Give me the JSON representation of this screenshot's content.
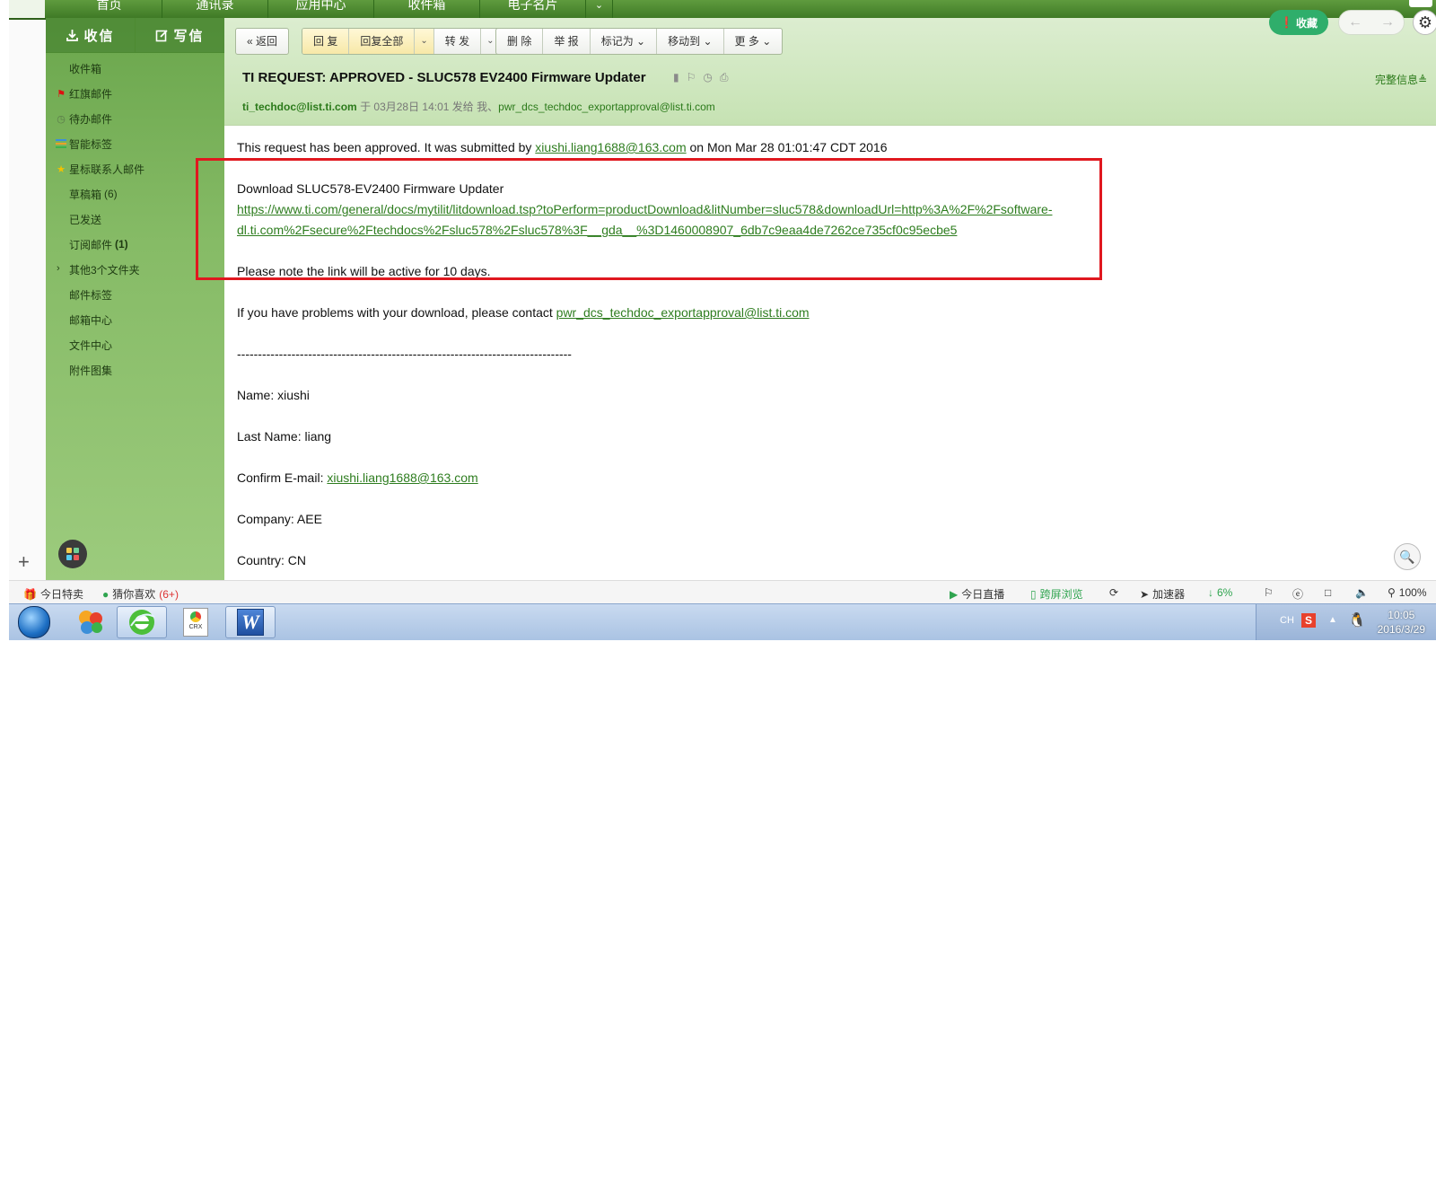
{
  "top_nav": {
    "tabs": [
      "首页",
      "通讯录",
      "应用中心",
      "收件箱",
      "电子名片"
    ],
    "dropdown": "⌄"
  },
  "sidebar": {
    "receive_label": "收信",
    "compose_label": "写信",
    "items": [
      {
        "label": "收件箱",
        "count": "",
        "icon": ""
      },
      {
        "label": "红旗邮件",
        "count": "",
        "icon": "flag-icon"
      },
      {
        "label": "待办邮件",
        "count": "",
        "icon": "clock-icon"
      },
      {
        "label": "智能标签",
        "count": "",
        "icon": "tags-icon"
      },
      {
        "label": "星标联系人邮件",
        "count": "",
        "icon": "star-icon"
      },
      {
        "label": "草稿箱",
        "count": "(6)",
        "icon": ""
      },
      {
        "label": "已发送",
        "count": "",
        "icon": ""
      },
      {
        "label": "订阅邮件",
        "count": "(1)",
        "icon": ""
      },
      {
        "label": "其他3个文件夹",
        "count": "",
        "icon": "chevron-right-icon"
      },
      {
        "label": "邮件标签",
        "count": "",
        "icon": ""
      },
      {
        "label": "邮箱中心",
        "count": "",
        "icon": ""
      },
      {
        "label": "文件中心",
        "count": "",
        "icon": ""
      },
      {
        "label": "附件图集",
        "count": "",
        "icon": ""
      }
    ]
  },
  "toolbar": {
    "back": "返回",
    "reply": "回 复",
    "reply_all": "回复全部",
    "forward": "转 发",
    "delete": "删 除",
    "report": "举 报",
    "mark_as": "标记为",
    "move_to": "移动到",
    "more": "更 多",
    "favorite": "收藏"
  },
  "message": {
    "subject": "TI REQUEST: APPROVED - SLUC578 EV2400 Firmware Updater",
    "full_info": "完整信息",
    "sender": "ti_techdoc@list.ti.com",
    "date_meta": " 于 03月28日 14:01 发给 我、",
    "recipient": "pwr_dcs_techdoc_exportapproval@list.ti.com"
  },
  "body": {
    "l1_pre": "This request has been approved. It was submitted by ",
    "l1_link": "xiushi.liang1688@163.com",
    "l1_post": " on Mon Mar 28 01:01:47 CDT 2016",
    "download_title": "Download SLUC578-EV2400 Firmware Updater",
    "download_url_1": "https://www.ti.com/general/docs/mytilit/litdownload.tsp?toPerform=productDownload&litNumber=sluc578&downloadUrl=http%3A%2F%2Fsoftware-",
    "download_url_2": "dl.ti.com%2Fsecure%2Ftechdocs%2Fsluc578%2Fsluc578%3F__gda__%3D1460008907_6db7c9eaa4de7262ce735cf0c95ecbe5",
    "active_note": "Please note the link will be active for 10 days.",
    "problems_pre": "If you have problems with your download, please contact ",
    "problems_link": "pwr_dcs_techdoc_exportapproval@list.ti.com",
    "separator": "--------------------------------------------------------------------------------",
    "name": "Name: xiushi",
    "last_name": "Last Name: liang",
    "confirm_pre": "Confirm E-mail: ",
    "confirm_link": "xiushi.liang1688@163.com",
    "company": "Company: AEE",
    "country": "Country: CN"
  },
  "status_bar": {
    "today_deals": "今日特卖",
    "guess_like": "猜你喜欢",
    "guess_count": "(6+)",
    "live": "今日直播",
    "cross_screen": "跨屏浏览",
    "accelerator": "加速器",
    "download_pct": "6%",
    "zoom": "100%"
  },
  "taskbar": {
    "time": "10:05",
    "date": "2016/3/29",
    "lang": "CH",
    "crx_label": "CRX"
  },
  "colors": {
    "accent_green": "#2e7d1f",
    "highlight_red": "#e0181f",
    "sidebar_green": "#86bb66"
  }
}
